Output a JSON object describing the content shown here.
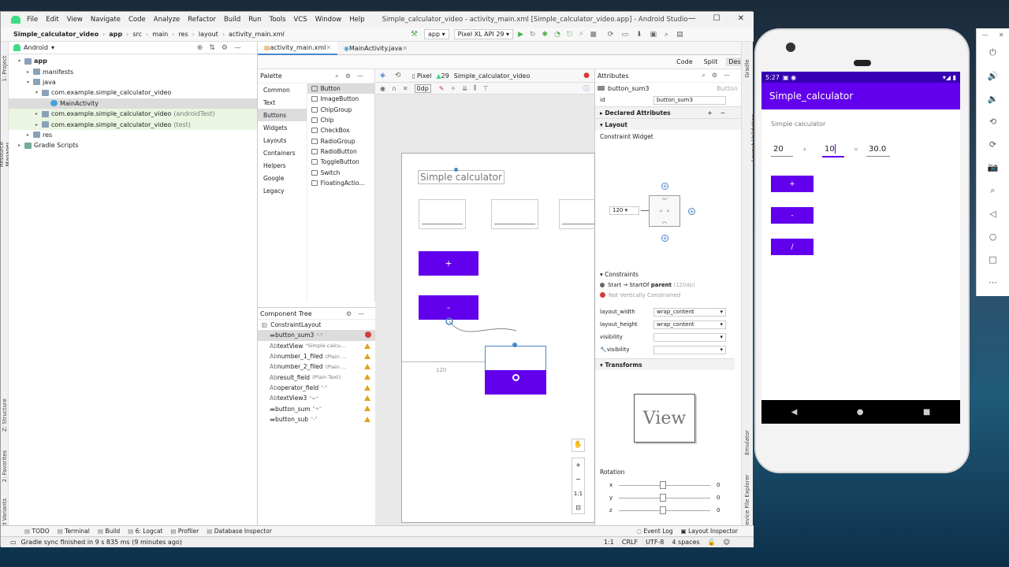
{
  "window": {
    "title": "Simple_calculator_video - activity_main.xml [Simple_calculator_video.app] - Android Studio",
    "menu": [
      "File",
      "Edit",
      "View",
      "Navigate",
      "Code",
      "Analyze",
      "Refactor",
      "Build",
      "Run",
      "Tools",
      "VCS",
      "Window",
      "Help"
    ]
  },
  "breadcrumb": [
    "Simple_calculator_video",
    "app",
    "src",
    "main",
    "res",
    "layout",
    "activity_main.xml"
  ],
  "toolbar": {
    "run_config": "app",
    "device": "Pixel XL API 29"
  },
  "left_strip": [
    "1: Project",
    "Resource Manager",
    "Z: Structure",
    "2: Favorites",
    "Build Variants"
  ],
  "project": {
    "view_mode": "Android",
    "tree": [
      {
        "label": "app",
        "bold": true,
        "level": 0,
        "icon": "folder",
        "state": "open"
      },
      {
        "label": "manifests",
        "level": 1,
        "icon": "folder",
        "state": "closed"
      },
      {
        "label": "java",
        "level": 1,
        "icon": "folder",
        "state": "open"
      },
      {
        "label": "com.example.simple_calculator_video",
        "level": 2,
        "icon": "folder",
        "state": "open"
      },
      {
        "label": "MainActivity",
        "level": 3,
        "icon": "class",
        "state": "none",
        "selected": true
      },
      {
        "label": "com.example.simple_calculator_video",
        "suffix": "(androidTest)",
        "level": 2,
        "icon": "folder",
        "state": "closed",
        "green": true
      },
      {
        "label": "com.example.simple_calculator_video",
        "suffix": "(test)",
        "level": 2,
        "icon": "folder",
        "state": "closed",
        "green": true
      },
      {
        "label": "res",
        "level": 1,
        "icon": "folder",
        "state": "closed"
      },
      {
        "label": "Gradle Scripts",
        "level": 0,
        "icon": "gradle",
        "state": "closed"
      }
    ]
  },
  "editor_tabs": [
    {
      "label": "activity_main.xml",
      "active": true
    },
    {
      "label": "MainActivity.java",
      "active": false
    }
  ],
  "view_modes": [
    "Code",
    "Split",
    "Design"
  ],
  "palette": {
    "title": "Palette",
    "categories": [
      "Common",
      "Text",
      "Buttons",
      "Widgets",
      "Layouts",
      "Containers",
      "Helpers",
      "Google",
      "Legacy"
    ],
    "selected_category": "Buttons",
    "items": [
      "Button",
      "ImageButton",
      "ChipGroup",
      "Chip",
      "CheckBox",
      "RadioGroup",
      "RadioButton",
      "ToggleButton",
      "Switch",
      "FloatingActio..."
    ]
  },
  "design_toolbar": {
    "device": "Pixel",
    "api": "29",
    "theme": "Simple_calculator_video",
    "margin": "0dp"
  },
  "component_tree": {
    "title": "Component Tree",
    "root": "ConstraintLayout",
    "rows": [
      {
        "name": "button_sum3",
        "detail": "\"-\"",
        "status": "error",
        "selected": true
      },
      {
        "name": "textView",
        "detail": "\"Simple calcu...",
        "status": "warning"
      },
      {
        "name": "number_1_filed",
        "detail": "(Plain ...",
        "status": "warning"
      },
      {
        "name": "number_2_filed",
        "detail": "(Plain ...",
        "status": "warning"
      },
      {
        "name": "result_field",
        "detail": "(Plain Text)",
        "status": "warning"
      },
      {
        "name": "operator_field",
        "detail": "\"-\"",
        "status": "warning"
      },
      {
        "name": "textView3",
        "detail": "\"=\"",
        "status": "warning"
      },
      {
        "name": "button_sum",
        "detail": "\"+\"",
        "status": "warning"
      },
      {
        "name": "button_sub",
        "detail": "\"-\"",
        "status": "warning"
      }
    ]
  },
  "canvas": {
    "heading": "Simple calculator",
    "plus_label": "+",
    "minus_label": "-",
    "margin_label": "120",
    "zoom_fit": "1:1"
  },
  "attributes": {
    "title": "Attributes",
    "selected": "button_sum3",
    "selected_type": "Button",
    "id_label": "id",
    "id_value": "button_sum3",
    "declared": "Declared Attributes",
    "layout": "Layout",
    "constraint_widget": "Constraint Widget",
    "margin_value": "120",
    "constraints_title": "Constraints",
    "constraint_start_prefix": "Start → StartOf",
    "constraint_start_parent": "parent",
    "constraint_start_dp": "(120dp)",
    "constraint_error": "Not Vertically Constrained",
    "layout_width_label": "layout_width",
    "layout_width": "wrap_content",
    "layout_height_label": "layout_height",
    "layout_height": "wrap_content",
    "visibility_label": "visibility",
    "visibility_tools_label": "visibility",
    "transforms": "Transforms",
    "view_preview": "View",
    "rotation": "Rotation",
    "rot": [
      {
        "axis": "x",
        "value": "0"
      },
      {
        "axis": "y",
        "value": "0"
      },
      {
        "axis": "z",
        "value": "0"
      }
    ]
  },
  "right_strip": [
    "Gradle",
    "Layout Validation",
    "Emulator",
    "Device File Explorer"
  ],
  "bottom_tabs": [
    "TODO",
    "Terminal",
    "Build",
    "6: Logcat",
    "Profiler",
    "Database Inspector"
  ],
  "bottom_right": [
    "Event Log",
    "Layout Inspector"
  ],
  "status": {
    "message": "Gradle sync finished in 9 s 835 ms (9 minutes ago)",
    "pos": "1:1",
    "eol": "CRLF",
    "encoding": "UTF-8",
    "indent": "4 spaces"
  },
  "phone": {
    "time": "5:27",
    "app_title": "Simple_calculator",
    "heading": "Simple calculator",
    "num1": "20",
    "operator": "+",
    "num2": "10",
    "equals": "=",
    "result": "30.0",
    "buttons": [
      "+",
      "-",
      "/"
    ],
    "accent": "#6200ee"
  }
}
